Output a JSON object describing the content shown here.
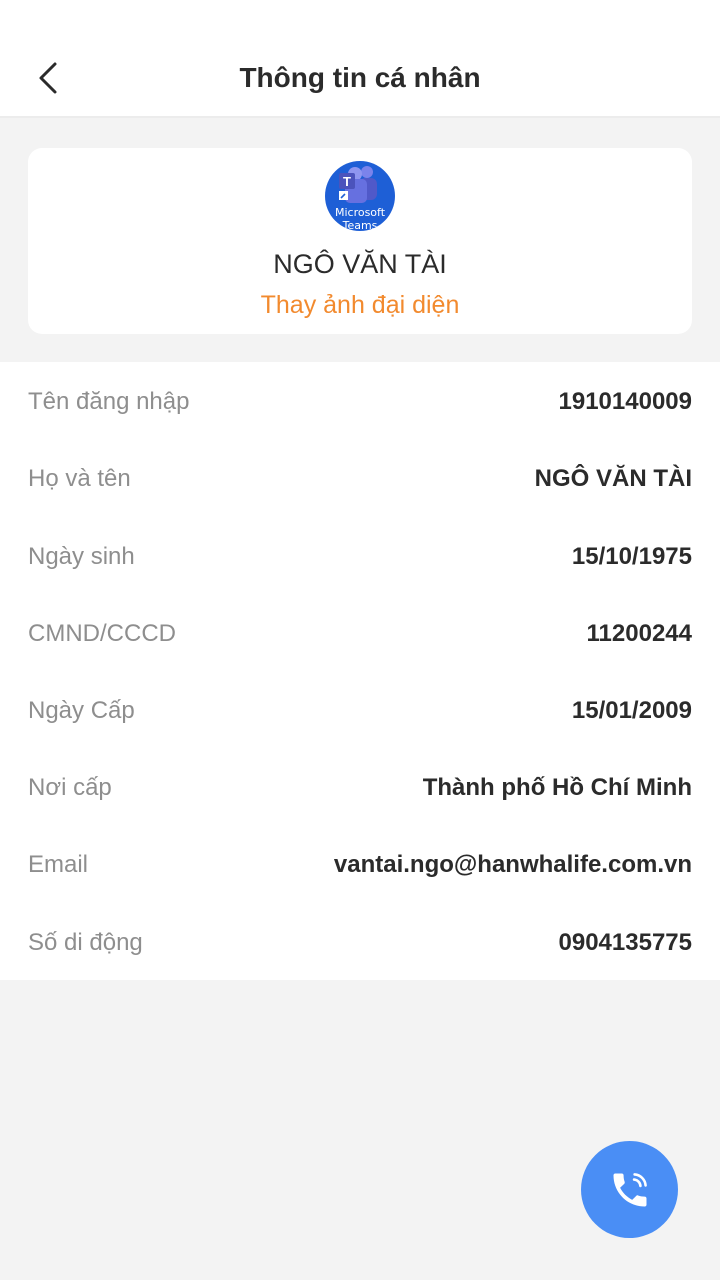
{
  "header": {
    "title": "Thông tin cá nhân",
    "back_icon": "chevron-left-icon"
  },
  "profile": {
    "avatar_caption_line1": "Microsoft",
    "avatar_caption_line2": "Teams",
    "name": "NGÔ VĂN TÀI",
    "change_avatar_label": "Thay ảnh đại diện"
  },
  "info": [
    {
      "label": "Tên đăng nhập",
      "value": "1910140009"
    },
    {
      "label": "Họ và tên",
      "value": "NGÔ VĂN TÀI"
    },
    {
      "label": "Ngày sinh",
      "value": "15/10/1975"
    },
    {
      "label": "CMND/CCCD",
      "value": "11200244"
    },
    {
      "label": "Ngày Cấp",
      "value": "15/01/2009"
    },
    {
      "label": "Nơi cấp",
      "value": "Thành phố Hồ Chí Minh"
    },
    {
      "label": "Email",
      "value": "vantai.ngo@hanwhalife.com.vn"
    },
    {
      "label": "Số di động",
      "value": "0904135775"
    }
  ],
  "colors": {
    "accent_orange": "#f28a2e",
    "fab_blue": "#4a8ef5",
    "background": "#f3f3f3"
  },
  "fab": {
    "icon": "phone-call-icon"
  }
}
